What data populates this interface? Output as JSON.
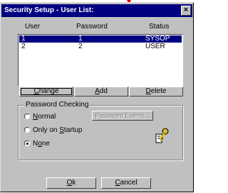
{
  "window": {
    "title_main": "Security Setup",
    "title_sep": "-",
    "title_sub": "User List:",
    "close_glyph": "×"
  },
  "columns": {
    "user": "User",
    "password": "Password",
    "status": "Status"
  },
  "users": [
    {
      "user": "1",
      "password": "1",
      "status": "SYSOP",
      "selected": true
    },
    {
      "user": "2",
      "password": "2",
      "status": "USER",
      "selected": false
    }
  ],
  "actions": {
    "change_accel": "C",
    "change_rest": "hange",
    "add_accel": "A",
    "add_rest": "dd",
    "delete_accel": "D",
    "delete_rest": "elete"
  },
  "password_checking": {
    "title": "Password Checking",
    "options": {
      "normal": {
        "pre": "",
        "accel": "N",
        "post": "ormal"
      },
      "startup": {
        "pre": "Only on ",
        "accel": "S",
        "post": "tartup"
      },
      "none": {
        "pre": "N",
        "accel": "o",
        "post": "ne"
      }
    },
    "selected": "None",
    "events_button": "Password Events..."
  },
  "footer": {
    "ok_accel": "O",
    "ok_rest": "k",
    "cancel_accel": "C",
    "cancel_rest": "ancel"
  },
  "colors": {
    "title_bar": "#000080",
    "face": "#c0c0c0",
    "selection": "#000080",
    "pointer": "#e00000"
  }
}
